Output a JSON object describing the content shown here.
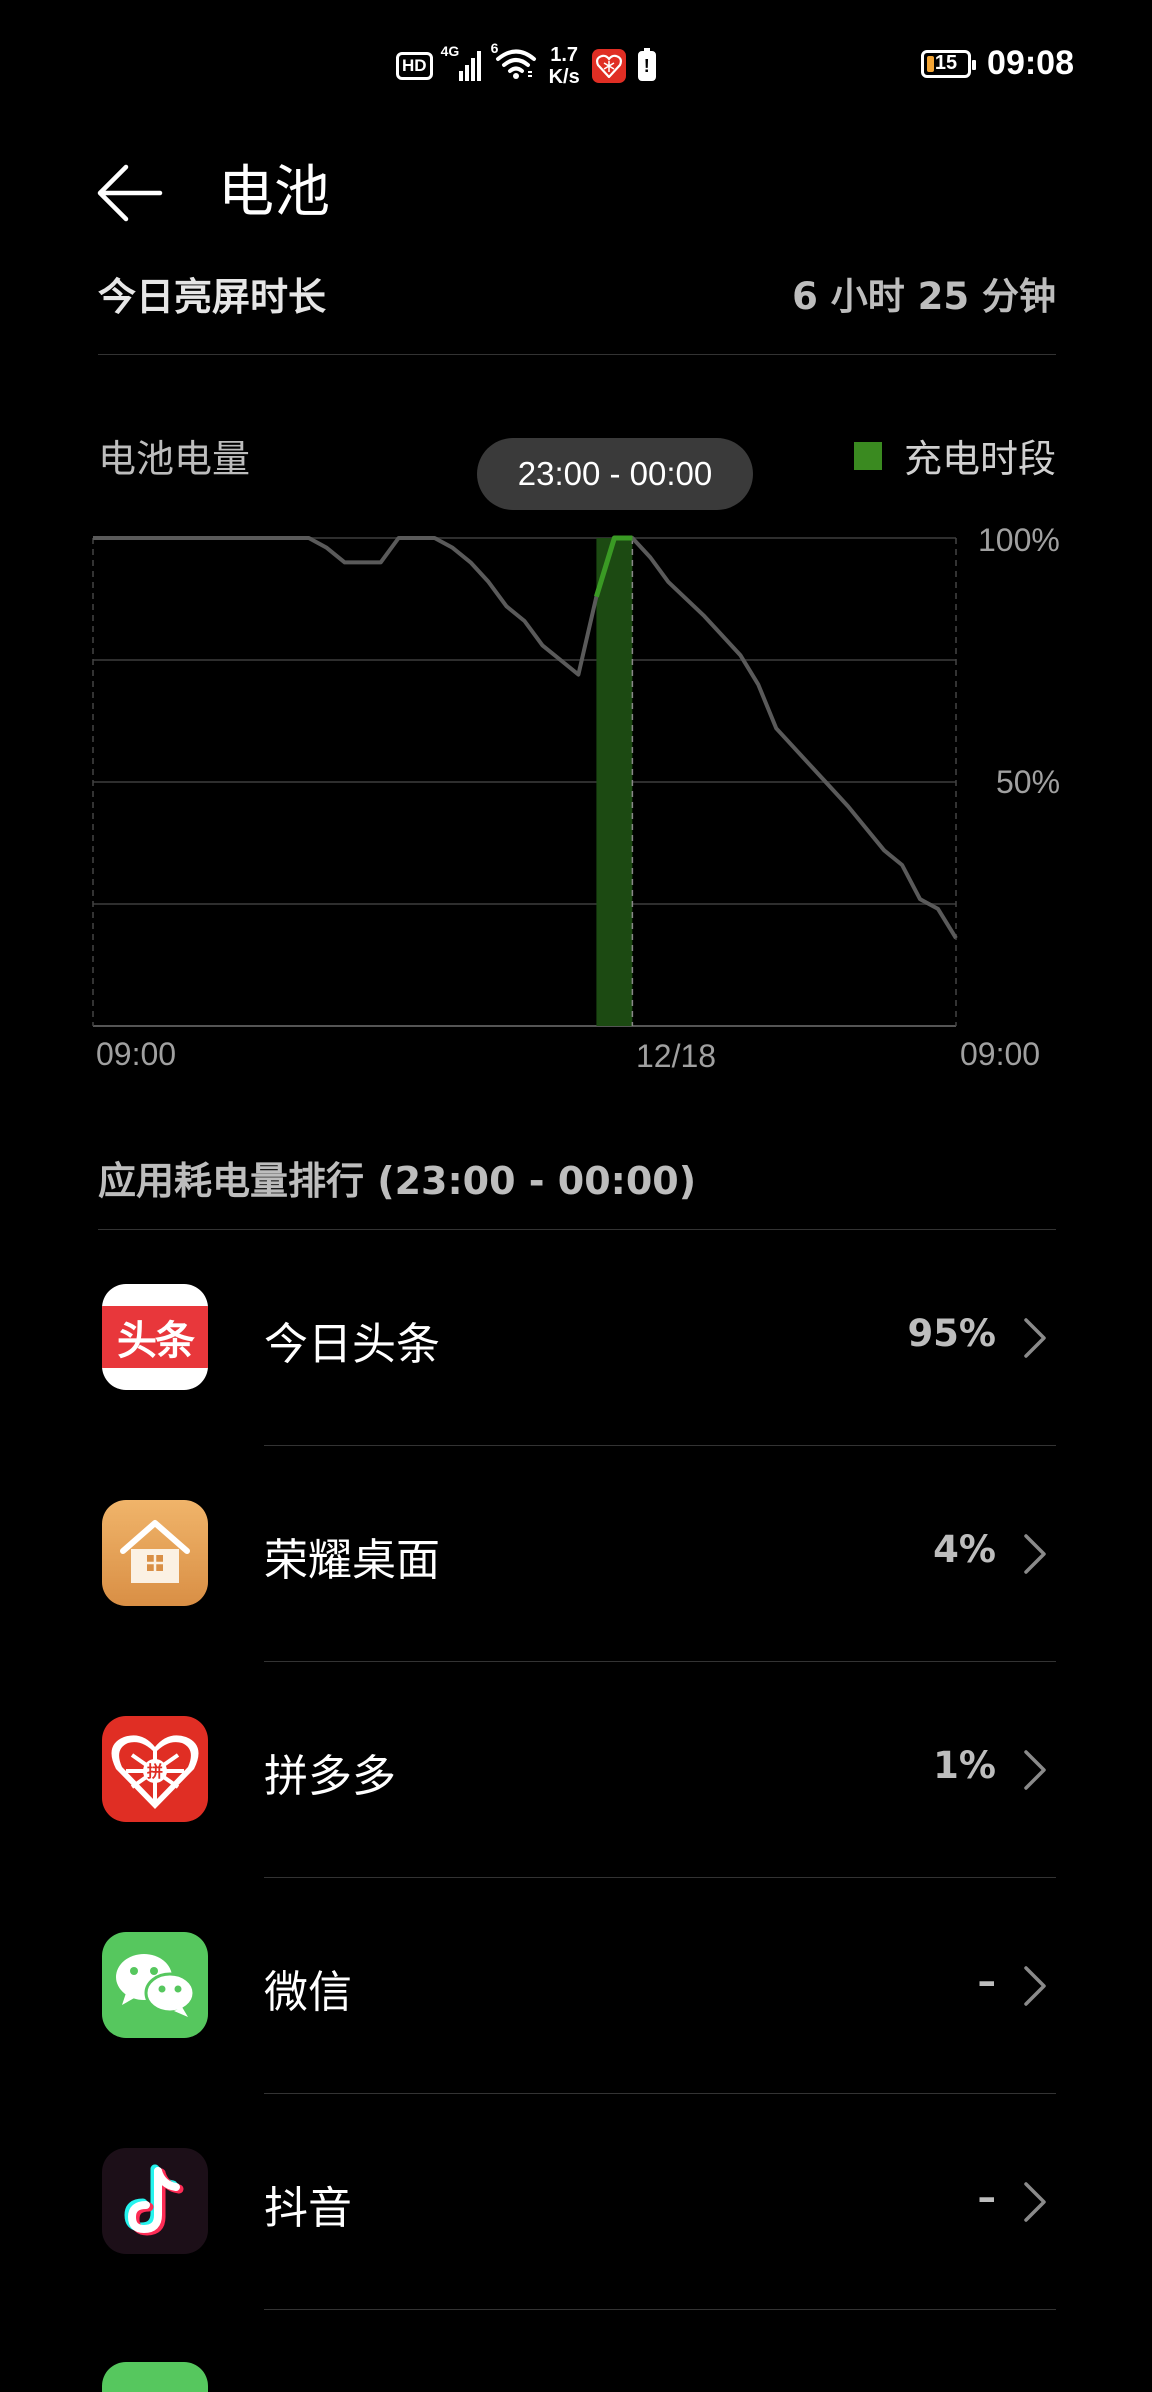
{
  "status_bar": {
    "hd": "HD",
    "net_4g": "4G",
    "wifi_6": "6",
    "speed_value": "1.7",
    "speed_unit": "K/s",
    "battery_level": "15",
    "time": "09:08"
  },
  "header": {
    "title": "电池"
  },
  "screen_time": {
    "label": "今日亮屏时长",
    "value": "6 小时 25 分钟"
  },
  "chart": {
    "title": "电池电量",
    "legend_label": "充电时段",
    "tooltip": "23:00 - 00:00",
    "colors": {
      "line": "#5a5a5a",
      "charging_fill": "#1c4a12",
      "charging_line": "#3a9a24"
    }
  },
  "chart_data": {
    "type": "line",
    "y_ticks": [
      "100%",
      "50%"
    ],
    "x_tick_labels": [
      "09:00",
      "12/18",
      "09:00"
    ],
    "ylim": [
      0,
      100
    ],
    "x_hours_range": [
      0,
      24
    ],
    "series": [
      {
        "points": [
          [
            0,
            100
          ],
          [
            6,
            100
          ],
          [
            6.5,
            98
          ],
          [
            7,
            95
          ],
          [
            8,
            95
          ],
          [
            8.5,
            100
          ],
          [
            9.5,
            100
          ],
          [
            10,
            98
          ],
          [
            10.5,
            95
          ],
          [
            11,
            91
          ],
          [
            11.5,
            86
          ],
          [
            12,
            83
          ],
          [
            12.5,
            78
          ],
          [
            13,
            75
          ],
          [
            13.5,
            72
          ],
          [
            14,
            88
          ],
          [
            14.5,
            100
          ],
          [
            15,
            100
          ],
          [
            15.5,
            96
          ],
          [
            16,
            91
          ],
          [
            17,
            84
          ],
          [
            18,
            76
          ],
          [
            18.5,
            70
          ],
          [
            19,
            61
          ],
          [
            20,
            53
          ],
          [
            21,
            45
          ],
          [
            22,
            36
          ],
          [
            22.5,
            33
          ],
          [
            23,
            26
          ],
          [
            23.5,
            24
          ],
          [
            24,
            18
          ]
        ]
      }
    ],
    "charging_period_hours": [
      14,
      15
    ],
    "charging_points": [
      [
        14,
        88
      ],
      [
        14.5,
        100
      ],
      [
        15,
        100
      ]
    ],
    "highlight_hour": 15
  },
  "ranking": {
    "title": "应用耗电量排行 (23:00 - 00:00)",
    "apps": [
      {
        "name": "今日头条",
        "value": "95%",
        "icon_text": "头条",
        "icon": "toutiao-icon"
      },
      {
        "name": "荣耀桌面",
        "value": "4%",
        "icon": "honor-home-icon"
      },
      {
        "name": "拼多多",
        "value": "1%",
        "icon": "pinduoduo-icon",
        "icon_text": "拼"
      },
      {
        "name": "微信",
        "value": "–",
        "icon": "wechat-icon"
      },
      {
        "name": "抖音",
        "value": "–",
        "icon": "douyin-icon"
      }
    ]
  }
}
